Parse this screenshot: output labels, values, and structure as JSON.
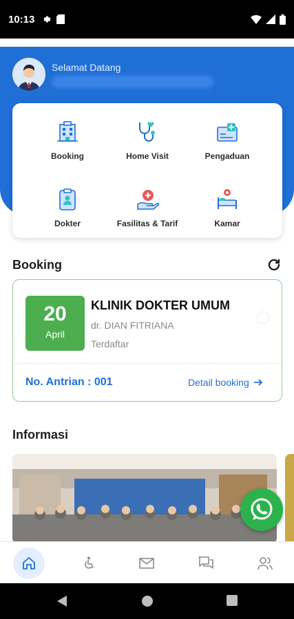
{
  "status_bar": {
    "time": "10:13"
  },
  "header": {
    "greeting": "Selamat Datang"
  },
  "menu": [
    {
      "label": "Booking",
      "icon": "hospital-building-icon"
    },
    {
      "label": "Home Visit",
      "icon": "stethoscope-heart-icon"
    },
    {
      "label": "Pengaduan",
      "icon": "medical-report-icon"
    },
    {
      "label": "Dokter",
      "icon": "clipboard-doctor-icon"
    },
    {
      "label": "Fasilitas & Tarif",
      "icon": "hand-medical-icon"
    },
    {
      "label": "Kamar",
      "icon": "hospital-bed-icon"
    }
  ],
  "booking": {
    "section_title": "Booking",
    "day": "20",
    "month": "April",
    "clinic": "KLINIK DOKTER UMUM",
    "doctor": "dr. DIAN FITRIANA",
    "status": "Terdaftar",
    "queue": "No. Antrian : 001",
    "detail_link": "Detail booking"
  },
  "informasi": {
    "section_title": "Informasi"
  },
  "bottom_nav": [
    {
      "name": "home",
      "icon": "home-icon",
      "active": true
    },
    {
      "name": "accessibility",
      "icon": "wheelchair-icon",
      "active": false
    },
    {
      "name": "mail",
      "icon": "mail-icon",
      "active": false
    },
    {
      "name": "chat",
      "icon": "chat-icon",
      "active": false
    },
    {
      "name": "profile",
      "icon": "users-icon",
      "active": false
    }
  ],
  "colors": {
    "primary": "#1f6fd6",
    "success": "#4cae4f",
    "whatsapp": "#2bb24c"
  }
}
